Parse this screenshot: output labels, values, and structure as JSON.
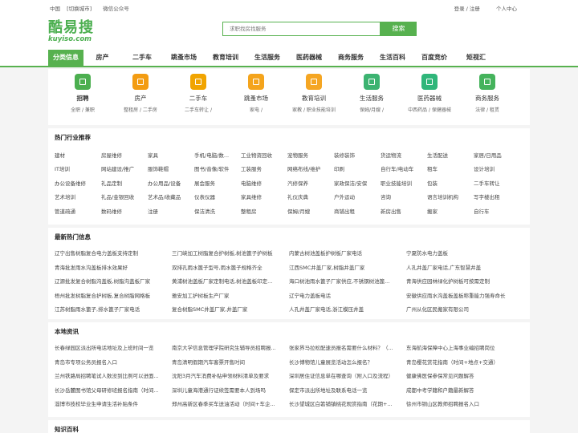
{
  "topbar": {
    "region": "中国",
    "switch_city": "[切换城市]",
    "wechat": "微信公众号",
    "login": "登录 / 注册",
    "user_center": "个人中心"
  },
  "header": {
    "logo_cn": "酷易搜",
    "logo_en": "kuyiso.com",
    "search_placeholder": "求职找房找服务",
    "search_button": "搜索"
  },
  "nav": [
    "分类信息",
    "房产",
    "二手车",
    "跳蚤市场",
    "教育培训",
    "生活服务",
    "医药器械",
    "商务服务",
    "生活百科",
    "百度竞价",
    "矩视汇"
  ],
  "categories": [
    {
      "name": "招聘",
      "sub": "全职 / 兼职",
      "color": "#4caf50",
      "icon": "briefcase-icon"
    },
    {
      "name": "房产",
      "sub": "整租房 / 二手房",
      "color": "#f39c12",
      "icon": "building-icon"
    },
    {
      "name": "二手车",
      "sub": "二手车转让 /",
      "color": "#f1a400",
      "icon": "car-icon"
    },
    {
      "name": "跳蚤市场",
      "sub": "家电 /",
      "color": "#f4a41c",
      "icon": "shopping-bag-icon"
    },
    {
      "name": "教育培训",
      "sub": "家教 / 职业技能培训",
      "color": "#f5a623",
      "icon": "graduation-cap-icon"
    },
    {
      "name": "生活服务",
      "sub": "保姆/月嫂 /",
      "color": "#3cb371",
      "icon": "house-icon"
    },
    {
      "name": "医药器械",
      "sub": "中西药品 / 保健器械",
      "color": "#2fb67a",
      "icon": "medical-kit-icon"
    },
    {
      "name": "商务服务",
      "sub": "法律 / 租赁",
      "color": "#45b35c",
      "icon": "handshake-icon"
    }
  ],
  "hot_industries": {
    "title": "热门行业推荐",
    "rows": [
      [
        "建材",
        "房屋维修",
        "家具",
        "手机/电脑/数...",
        "工业物资回收",
        "宠物服务",
        "装修装饰",
        "货运物流",
        "生活配送",
        "家居/日用品"
      ],
      [
        "IT培训",
        "网站建设/推广",
        "服饰鞋帽",
        "图书/音像/软件",
        "工装服务",
        "网络布线/维护",
        "印刷",
        "自行车/电动车",
        "租车",
        "设计培训"
      ],
      [
        "办公设备维修",
        "礼品定制",
        "办公用品/设备",
        "展会服务",
        "电脑维修",
        "汽修保养",
        "家政保洁/安保",
        "职业技能培训",
        "包装",
        "二手车转让"
      ],
      [
        "艺术培训",
        "礼品/金银回收",
        "艺术品/收藏品",
        "仪表仪器",
        "家具维修",
        "礼仪庆典",
        "户外运动",
        "咨询",
        "语言培训机构",
        "写字楼出租"
      ],
      [
        "管道疏通",
        "数码维修",
        "注册",
        "保洁清洗",
        "整租房",
        "保姆/月嫂",
        "商铺出租",
        "新房出售",
        "搬家",
        "自行车"
      ]
    ]
  },
  "latest_news": {
    "title": "最新热门信息",
    "rows": [
      [
        "辽宁出售树脂复合电力盖板支持定制",
        "三门峡加工树脂复合护树板,树池篦子护树板",
        "内蒙古树池盖板护树板厂家电话",
        "宁夏防水电力盖板"
      ],
      [
        "青海批发雨水沟盖板排水效果好",
        "双排孔雨水篦子型号,雨水篦子规格齐全",
        "江西SMC井盖厂家,树脂井盖厂家",
        "人孔井盖厂家电话,广东智慧井盖"
      ],
      [
        "辽源批发复合树脂沟盖板,树脂沟盖板厂家",
        "黄浦树池盖板厂家定制电话,树池盖板印定...",
        "海口树池雨水篦子厂家供应,不锈钢树池篦...",
        "青海供应园林绿化护树板可按需定制"
      ],
      [
        "梧州批发树脂复合护树板,复合树脂网格板",
        "雅安加工护树板生产厂家",
        "辽宁电力盖板电话",
        "安徽供应雨水沟盖板盖板称重能力强寿命长"
      ],
      [
        "江苏树脂雨水篦子,排水篦子厂家电话",
        "复合树脂SMC井盖厂家,井盖厂家",
        "人孔井盖厂家电话,浙江模压井盖",
        "广州从化区民搬家有限公司"
      ]
    ]
  },
  "local_news": {
    "title": "本地资讯",
    "rows": [
      [
        "长春绿园区派出所电话地址及上班时间一览",
        "南京大学信息管理学院研究生辅导员招聘报...",
        "张家界马拉松配速员报名需要什么材料？（...",
        "东海航海保障中心上海事业编招聘岗位"
      ],
      [
        "青岛市专项公务员报名入口",
        "青岛清明假期汽车客票开售时间",
        "长沙博物馆儿童展览活动怎么报名？",
        "青岛樱花赏花指南（时间+地点+交通）"
      ],
      [
        "兰州铁路局招聘笔试人数没到比例可以进面...",
        "沈阳3月汽车消费补贴申领材料清单及要求",
        "深圳居住证信息单在哪查询（附入口及流程）",
        "健康佛医保参保常见问题解答"
      ],
      [
        "长沙岳麓图书馆父母研修班报名指南（时间...",
        "深圳儿童海港通行证续签需要本人到场吗",
        "保定市派出所地址及联系电话一览",
        "成都中考学籍和户籍最新解答"
      ],
      [
        "淄博市技校毕业生申请生活补贴条件",
        "郑州高新区春季买车送油活动（时间+车企...",
        "长沙望城区白箬铺镇桃花观赏指南（花期+...",
        "徐州市铜山区教师招聘报名入口"
      ]
    ]
  },
  "knowledge": {
    "title": "知识百科"
  }
}
